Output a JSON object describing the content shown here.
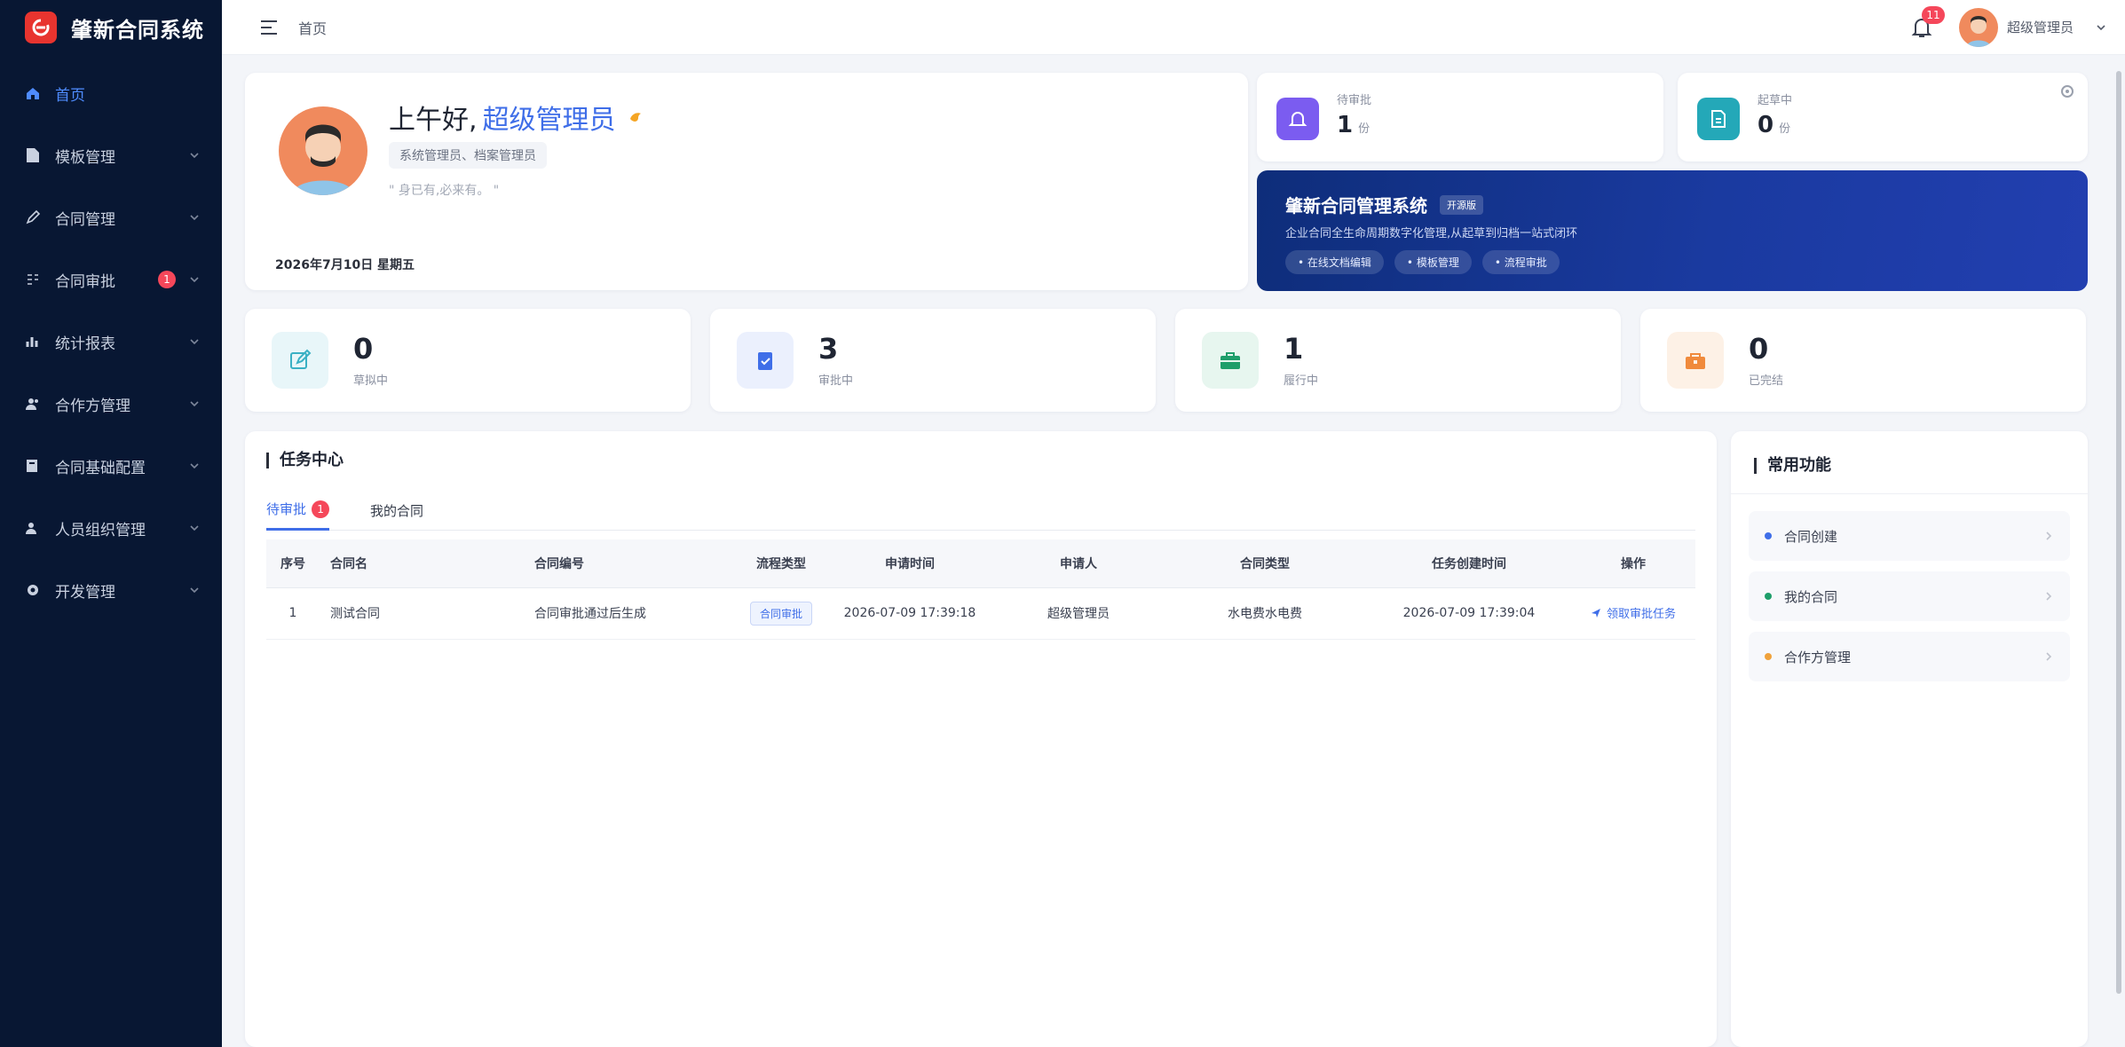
{
  "app": {
    "name": "肇新合同系统",
    "brand_color": "#e8342f",
    "sidebar_bg": "#081733",
    "accent": "#3f6ee8"
  },
  "sidebar": {
    "items": [
      {
        "label": "首页",
        "icon": "home-icon",
        "active": true
      },
      {
        "label": "模板管理",
        "icon": "file-icon"
      },
      {
        "label": "合同管理",
        "icon": "pen-icon"
      },
      {
        "label": "合同审批",
        "icon": "approval-icon",
        "badge": "1"
      },
      {
        "label": "统计报表",
        "icon": "chart-icon"
      },
      {
        "label": "合作方管理",
        "icon": "partner-icon"
      },
      {
        "label": "合同基础配置",
        "icon": "config-icon"
      },
      {
        "label": "人员组织管理",
        "icon": "people-icon"
      },
      {
        "label": "开发管理",
        "icon": "gear-icon"
      }
    ]
  },
  "header": {
    "breadcrumb": "首页",
    "notification_count": "11",
    "user_name": "超级管理员"
  },
  "welcome": {
    "greeting": "上午好,",
    "user_name": "超级管理员",
    "roles": "系统管理员、档案管理员",
    "motto": "\" 身已有,必来有。 \"",
    "date": "2026年7月10日 星期五"
  },
  "mini_stats": [
    {
      "label": "待审批",
      "value": "1",
      "unit": "份",
      "icon": "bell-icon",
      "color": "#7b5cf0"
    },
    {
      "label": "起草中",
      "value": "0",
      "unit": "份",
      "icon": "document-icon",
      "color": "#24a8b8"
    }
  ],
  "banner": {
    "title": "肇新合同管理系统",
    "tag": "开源版",
    "description": "企业合同全生命周期数字化管理,从起草到归档一站式闭环",
    "chips": [
      "在线文档编辑",
      "模板管理",
      "流程审批"
    ]
  },
  "stats": [
    {
      "value": "0",
      "label": "草拟中",
      "icon": "edit-icon",
      "color": "#3ab0c4",
      "bg": "#e8f6f9"
    },
    {
      "value": "3",
      "label": "审批中",
      "icon": "clipboard-check-icon",
      "color": "#3f6ee8",
      "bg": "#ebf0fd"
    },
    {
      "value": "1",
      "label": "履行中",
      "icon": "briefcase-icon",
      "color": "#1e9e6a",
      "bg": "#e7f6ef"
    },
    {
      "value": "0",
      "label": "已完结",
      "icon": "archive-icon",
      "color": "#f08a3c",
      "bg": "#fdf1e6"
    }
  ],
  "tasks": {
    "title": "任务中心",
    "tabs": [
      {
        "label": "待审批",
        "badge": "1",
        "active": true
      },
      {
        "label": "我的合同"
      }
    ],
    "columns": [
      "序号",
      "合同名",
      "合同编号",
      "流程类型",
      "申请时间",
      "申请人",
      "合同类型",
      "任务创建时间",
      "操作"
    ],
    "rows": [
      {
        "index": "1",
        "name": "测试合同",
        "number": "合同审批通过后生成",
        "flow_type": "合同审批",
        "applied_at": "2026-07-09 17:39:18",
        "applicant": "超级管理员",
        "contract_type": "水电费水电费",
        "task_created_at": "2026-07-09 17:39:04",
        "action": "领取审批任务"
      }
    ]
  },
  "common_functions": {
    "title": "常用功能",
    "items": [
      {
        "label": "合同创建",
        "dot_color": "#3f6ee8"
      },
      {
        "label": "我的合同",
        "dot_color": "#1e9e6a"
      },
      {
        "label": "合作方管理",
        "dot_color": "#f0a23c"
      }
    ]
  }
}
